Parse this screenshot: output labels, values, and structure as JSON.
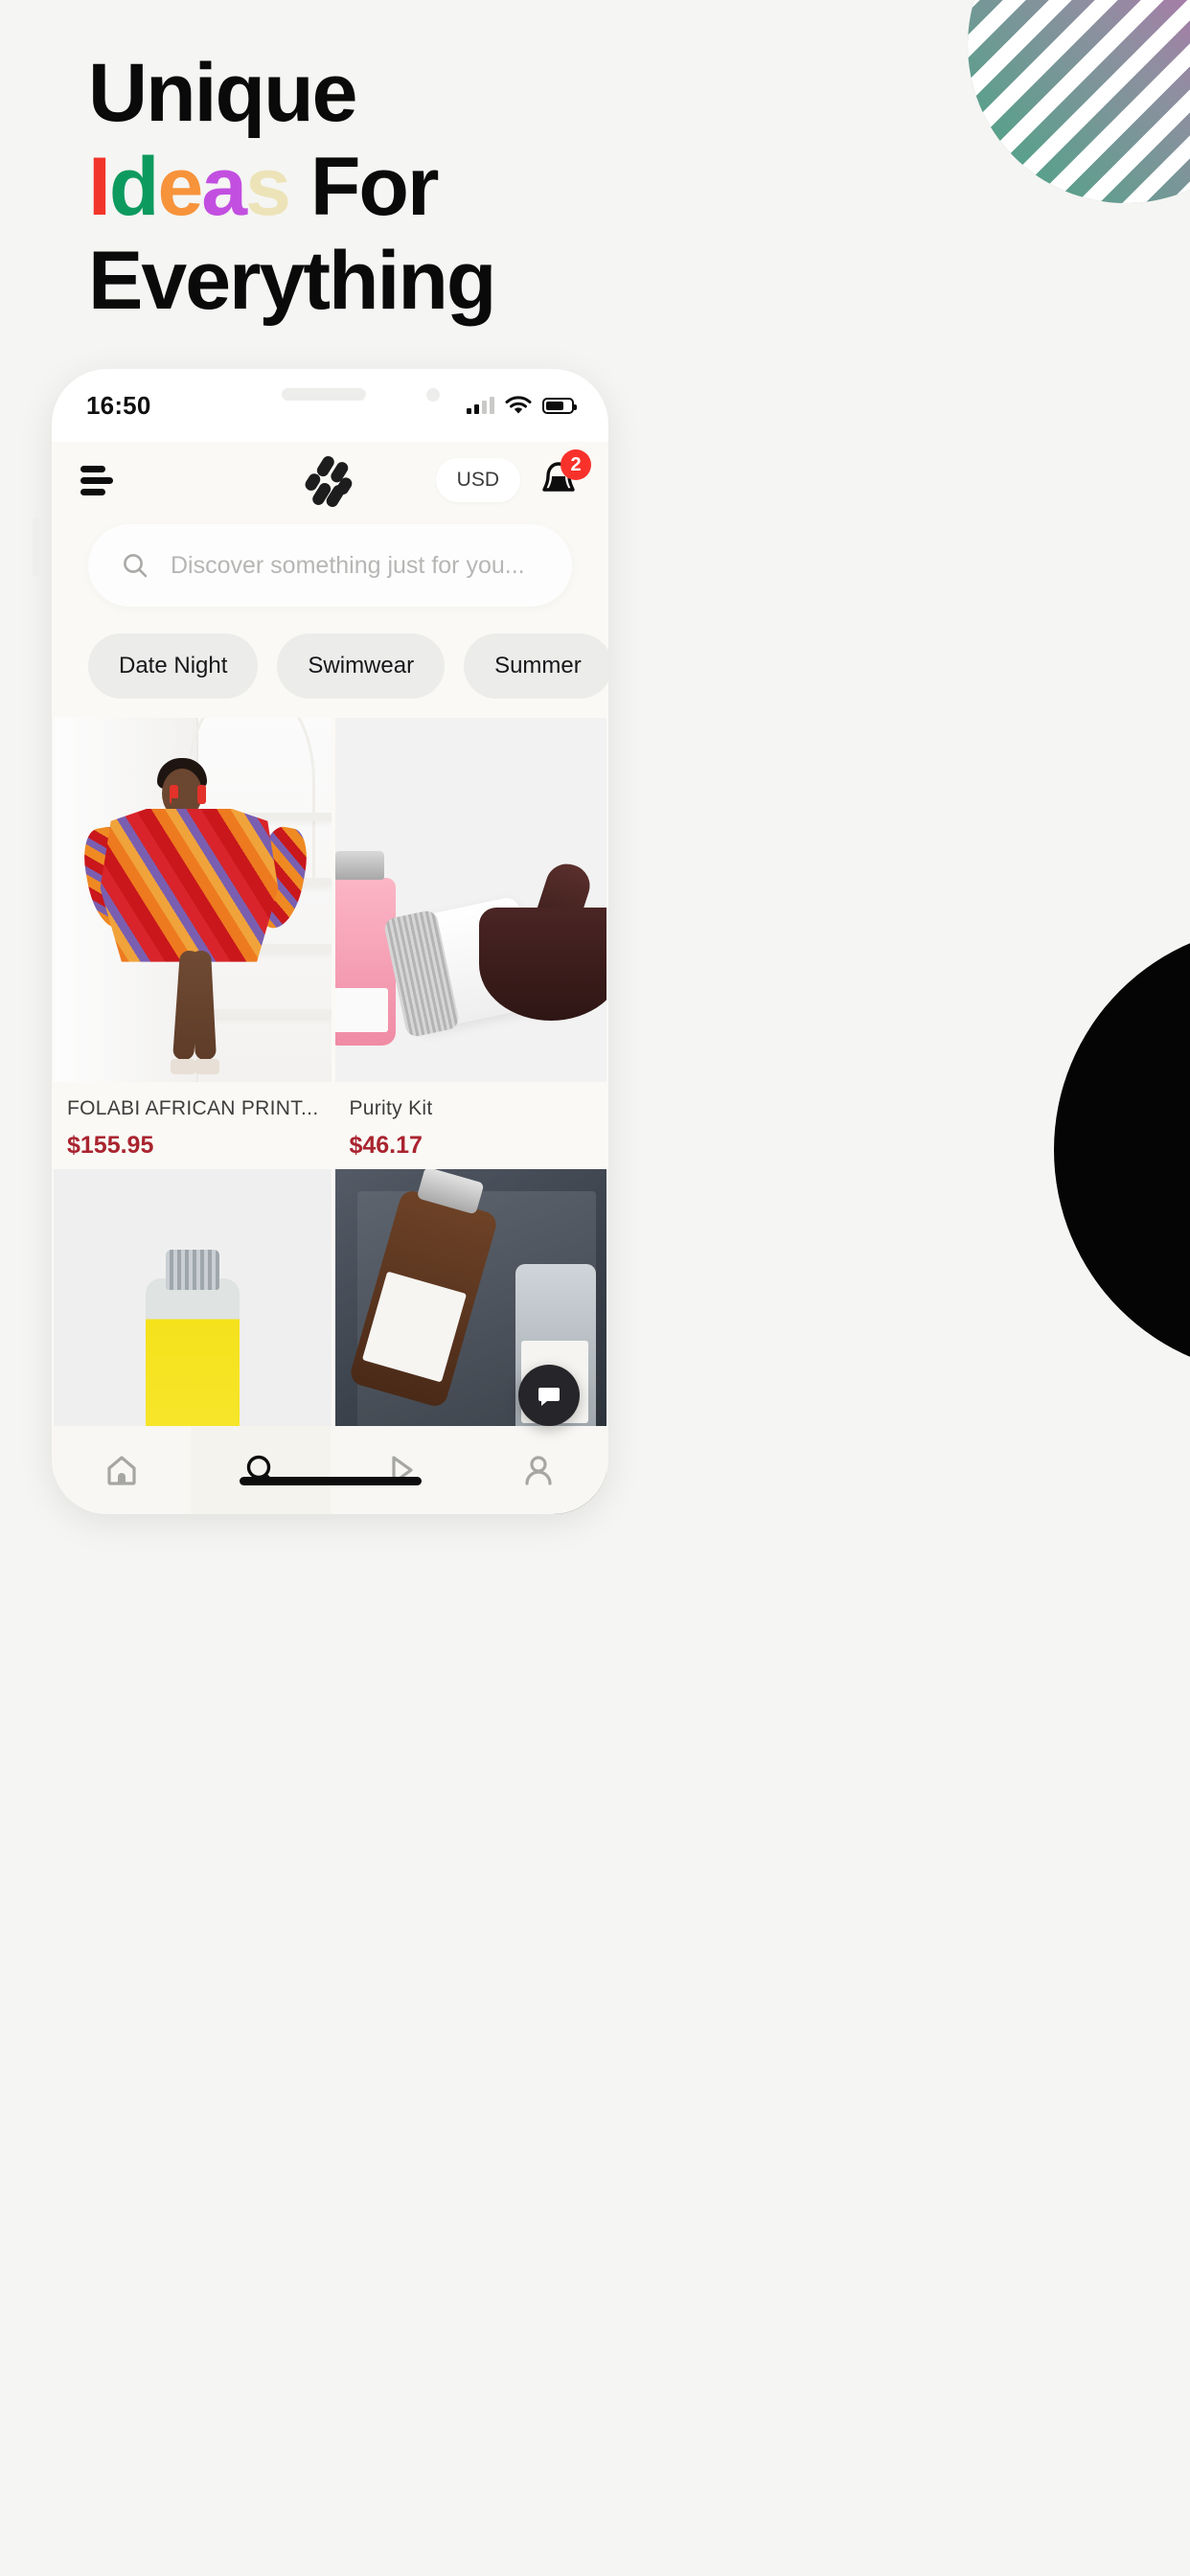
{
  "page": {
    "background": "#f5f5f3"
  },
  "headline": {
    "line1": "Unique",
    "line2_colored_chars": [
      {
        "ch": "I",
        "color": "#f2352a"
      },
      {
        "ch": "d",
        "color": "#0d9a5e"
      },
      {
        "ch": "e",
        "color": "#f7933b"
      },
      {
        "ch": "a",
        "color": "#c24fe0"
      },
      {
        "ch": "s",
        "color": "#ede3b8"
      }
    ],
    "line2_suffix": " For",
    "line3": "Everything"
  },
  "decor": {
    "stripe_circle": {
      "name": "striped-gradient-circle",
      "from": "#2faa78",
      "to": "#e950a8"
    },
    "black_circle": {
      "name": "black-circle",
      "color": "#050505"
    }
  },
  "phone": {
    "statusbar": {
      "time": "16:50",
      "signal_icon": "cellular-signal-icon",
      "wifi_icon": "wifi-icon",
      "battery_icon": "battery-icon"
    },
    "appbar": {
      "menu_icon": "hamburger-menu-icon",
      "logo_icon": "brand-logo-icon",
      "currency": "USD",
      "bell_icon": "notification-bell-icon",
      "bell_badge": "2"
    },
    "search": {
      "icon": "search-icon",
      "placeholder": "Discover something just for you...",
      "value": ""
    },
    "chips": [
      {
        "label": "Date Night"
      },
      {
        "label": "Swimwear"
      },
      {
        "label": "Summer"
      }
    ],
    "products": [
      {
        "art": "dress",
        "title": "FOLABI AFRICAN PRINT...",
        "price": "$155.95"
      },
      {
        "art": "purity",
        "title": "Purity Kit",
        "price": "$46.17"
      },
      {
        "art": "oil",
        "title": "",
        "price": ""
      },
      {
        "art": "box",
        "title": "",
        "price": ""
      }
    ],
    "fab": {
      "icon": "chat-bubble-icon"
    },
    "bottomnav": [
      {
        "icon": "home-icon",
        "active": false
      },
      {
        "icon": "search-icon",
        "active": true
      },
      {
        "icon": "play-video-icon",
        "active": false
      },
      {
        "icon": "profile-person-icon",
        "active": false
      }
    ],
    "home_indicator": "home-indicator-bar"
  },
  "colors": {
    "price": "#a9242f",
    "badge": "#f8322b",
    "app_bg": "#faf9f5"
  }
}
